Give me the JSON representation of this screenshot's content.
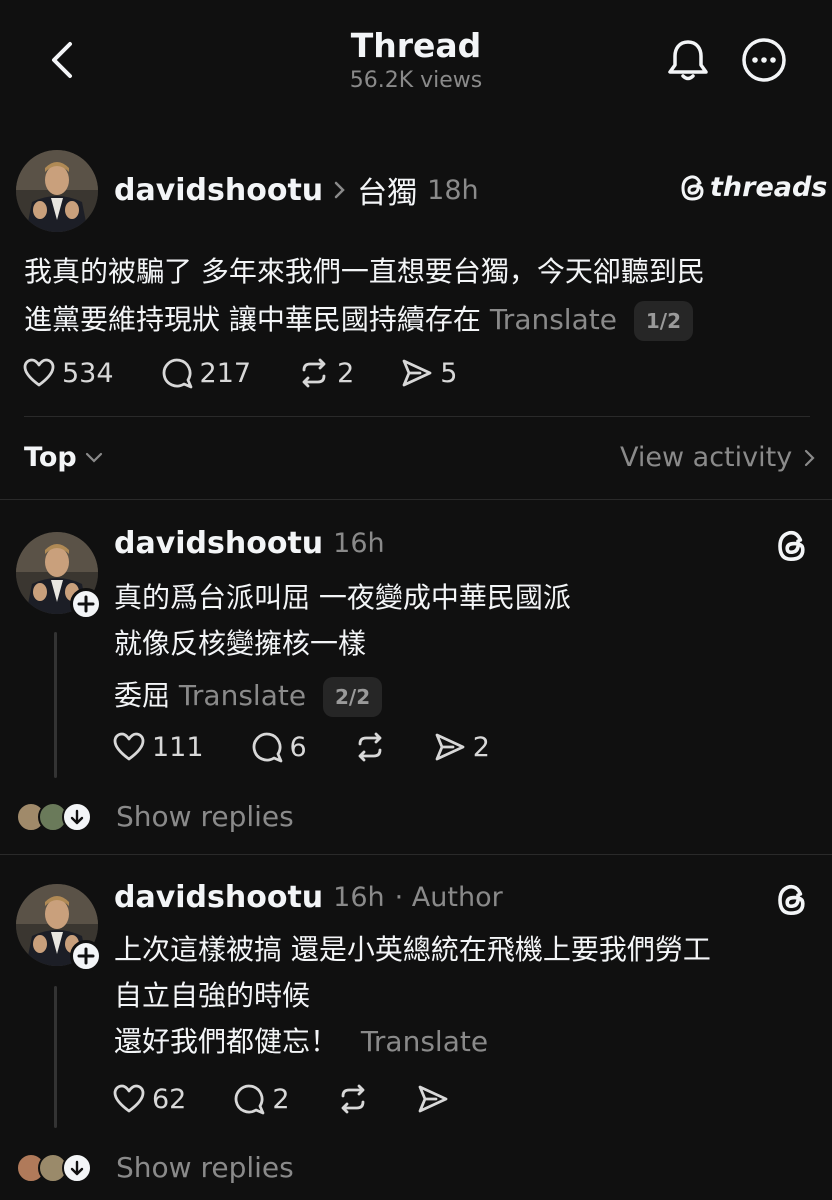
{
  "header": {
    "title": "Thread",
    "views": "56.2K views"
  },
  "root_post": {
    "username": "davidshootu",
    "topic": "台獨",
    "time": "18h",
    "brand": "threads",
    "line1": "我真的被騙了 多年來我們一直想要台獨，今天卻聽到民",
    "line2": "進黨要維持現狀 讓中華民國持續存在",
    "translate": "Translate",
    "pager": "1/2",
    "likes": "534",
    "comments": "217",
    "reposts": "2",
    "shares": "5"
  },
  "sort": {
    "label": "Top",
    "view_activity": "View activity"
  },
  "replies": [
    {
      "username": "davidshootu",
      "time": "16h",
      "author_tag": "",
      "line1": "真的爲台派叫屈 一夜變成中華民國派",
      "line2": "就像反核變擁核一樣",
      "line3": "委屈",
      "translate": "Translate",
      "pager": "2/2",
      "likes": "111",
      "comments": "6",
      "reposts": "",
      "shares": "2",
      "show_replies": "Show replies"
    },
    {
      "username": "davidshootu",
      "time": "16h",
      "author_tag": "· Author",
      "line1": "上次這樣被搞 還是小英總統在飛機上要我們勞工",
      "line2": "自立自強的時候",
      "line3": "還好我們都健忘！",
      "translate": "Translate",
      "likes": "62",
      "comments": "2",
      "reposts": "",
      "shares": "",
      "show_replies": "Show replies"
    }
  ],
  "colors": {
    "background": "#101010",
    "text": "#f3f5f7",
    "muted": "#8a8a8a"
  }
}
